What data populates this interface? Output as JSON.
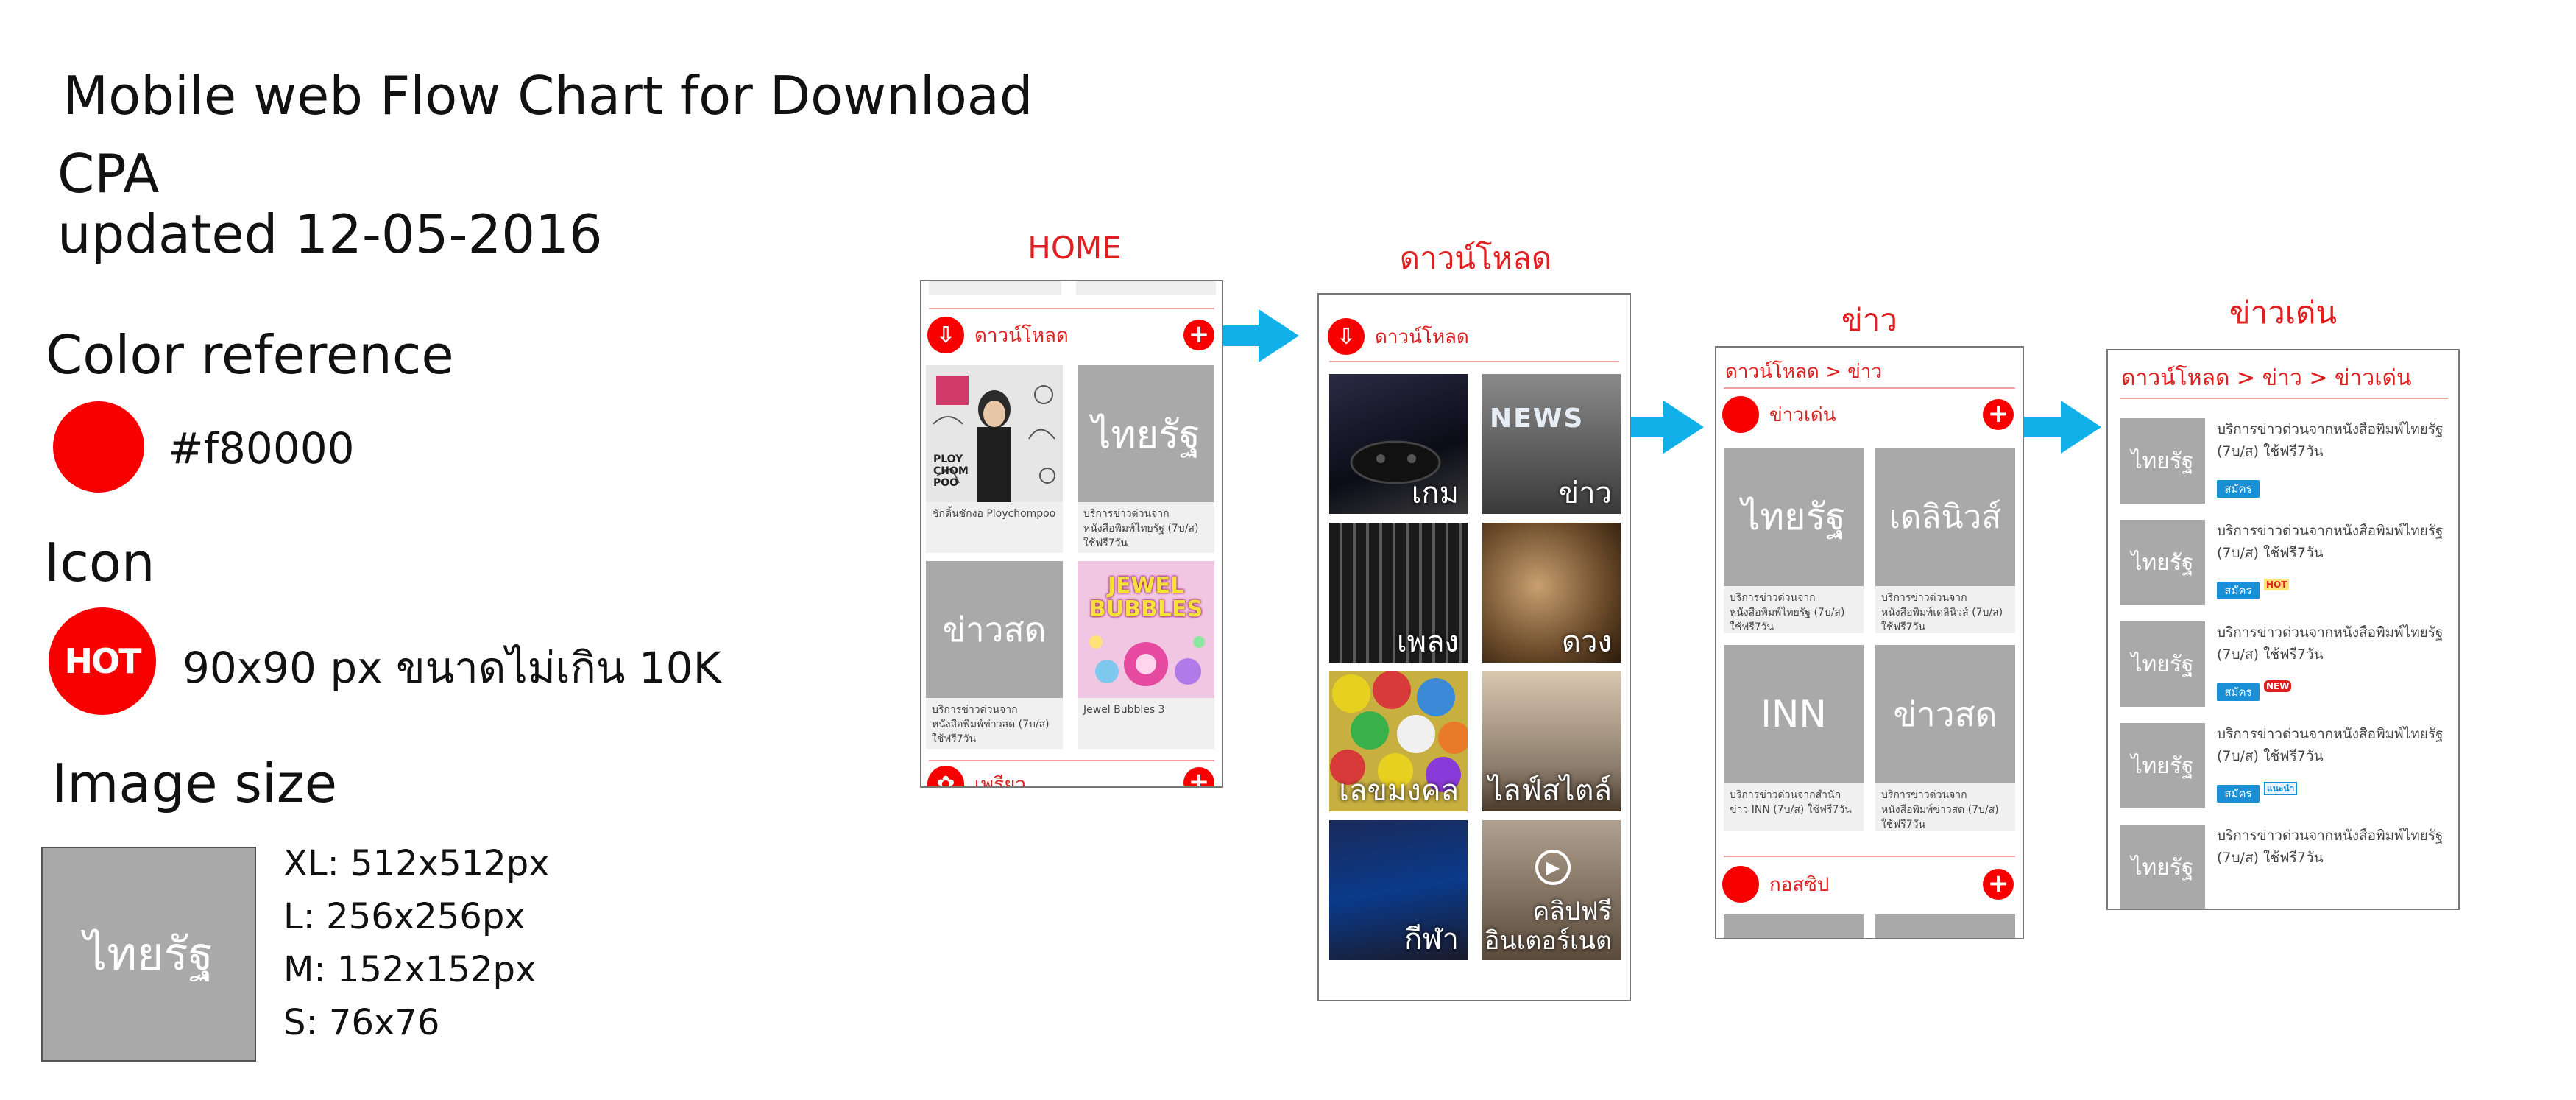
{
  "header": {
    "title": "Mobile web Flow Chart for Download",
    "subtitle_line1": "CPA",
    "subtitle_line2": "updated 12-05-2016"
  },
  "color_reference": {
    "heading": "Color reference",
    "hex_label": "#f80000",
    "swatch_color": "#f80000"
  },
  "icon_section": {
    "heading": "Icon",
    "icon_text": "HOT",
    "spec": "90x90 px ขนาดไม่เกิน 10K"
  },
  "image_size": {
    "heading": "Image size",
    "sample_label": "ไทยรัฐ",
    "sizes": [
      "XL: 512x512px",
      "L: 256x256px",
      "M: 152x152px",
      "S: 76x76"
    ]
  },
  "colors": {
    "accent": "#f80000",
    "red_text": "#e02020",
    "arrow": "#12b0e8",
    "pink_rule": "#f2a0a0",
    "blue_btn": "#1a8fd6",
    "placeholder": "#a9a9a9"
  },
  "screens": {
    "home": {
      "title": "HOME",
      "section_label": "ดาวน์โหลด",
      "plus": "+",
      "cards": [
        {
          "thumb": "",
          "caption": "ชักดิ้นชักงอ Ploychompoo"
        },
        {
          "thumb": "ไทยรัฐ",
          "caption": "บริการข่าวด่วนจากหนังสือพิมพ์ไทยรัฐ (7บ/ส) ใช้ฟรี7วัน"
        },
        {
          "thumb": "ข่าวสด",
          "caption": "บริการข่าวด่วนจากหนังสือพิมพ์ข่าวสด (7บ/ส) ใช้ฟรี7วัน"
        },
        {
          "thumb": "JEWEL BUBBLES",
          "caption": "Jewel Bubbles 3"
        }
      ],
      "poster_text": "PLOY CHOM POO",
      "next_section_label": "เพรียว"
    },
    "download": {
      "title": "ดาวน์โหลด",
      "section_label": "ดาวน์โหลด",
      "tiles": [
        "เกม",
        "ข่าว",
        "เพลง",
        "ดวง",
        "เลขมงคล",
        "ไลฟ์สไตล์",
        "กีฬา",
        "คลิปฟรี อินเตอร์เนต"
      ],
      "news_word": "NEWS"
    },
    "news": {
      "title": "ข่าว",
      "breadcrumb": "ดาวน์โหลด > ข่าว",
      "section_label": "ข่าวเด่น",
      "cards": [
        {
          "thumb": "ไทยรัฐ",
          "caption": "บริการข่าวด่วนจากหนังสือพิมพ์ไทยรัฐ (7บ/ส) ใช้ฟรี7วัน"
        },
        {
          "thumb": "เดลินิวส์",
          "caption": "บริการข่าวด่วนจากหนังสือพิมพ์เดลินิวส์ (7บ/ส) ใช้ฟรี7วัน"
        },
        {
          "thumb": "INN",
          "caption": "บริการข่าวด่วนจากสำนักข่าว INN (7บ/ส) ใช้ฟรี7วัน"
        },
        {
          "thumb": "ข่าวสด",
          "caption": "บริการข่าวด่วนจากหนังสือพิมพ์ข่าวสด (7บ/ส) ใช้ฟรี7วัน"
        }
      ],
      "next_section_label": "กอสซิป"
    },
    "top_news": {
      "title": "ข่าวเด่น",
      "breadcrumb": "ดาวน์โหลด > ข่าว > ข่าวเด่น",
      "items": [
        {
          "thumb": "ไทยรัฐ",
          "line1": "บริการข่าวด่วนจากหนังสือพิมพ์ไทยรัฐ",
          "line2": "(7บ/ส) ใช้ฟรี7วัน",
          "button": "สมัคร",
          "tag": ""
        },
        {
          "thumb": "ไทยรัฐ",
          "line1": "บริการข่าวด่วนจากหนังสือพิมพ์ไทยรัฐ",
          "line2": "(7บ/ส) ใช้ฟรี7วัน",
          "button": "สมัคร",
          "tag": "HOT"
        },
        {
          "thumb": "ไทยรัฐ",
          "line1": "บริการข่าวด่วนจากหนังสือพิมพ์ไทยรัฐ",
          "line2": "(7บ/ส) ใช้ฟรี7วัน",
          "button": "สมัคร",
          "tag": "NEW"
        },
        {
          "thumb": "ไทยรัฐ",
          "line1": "บริการข่าวด่วนจากหนังสือพิมพ์ไทยรัฐ",
          "line2": "(7บ/ส) ใช้ฟรี7วัน",
          "button": "สมัคร",
          "tag": "แนะนำ"
        },
        {
          "thumb": "ไทยรัฐ",
          "line1": "บริการข่าวด่วนจากหนังสือพิมพ์ไทยรัฐ",
          "line2": "(7บ/ส) ใช้ฟรี7วัน",
          "button": "",
          "tag": ""
        }
      ]
    }
  }
}
